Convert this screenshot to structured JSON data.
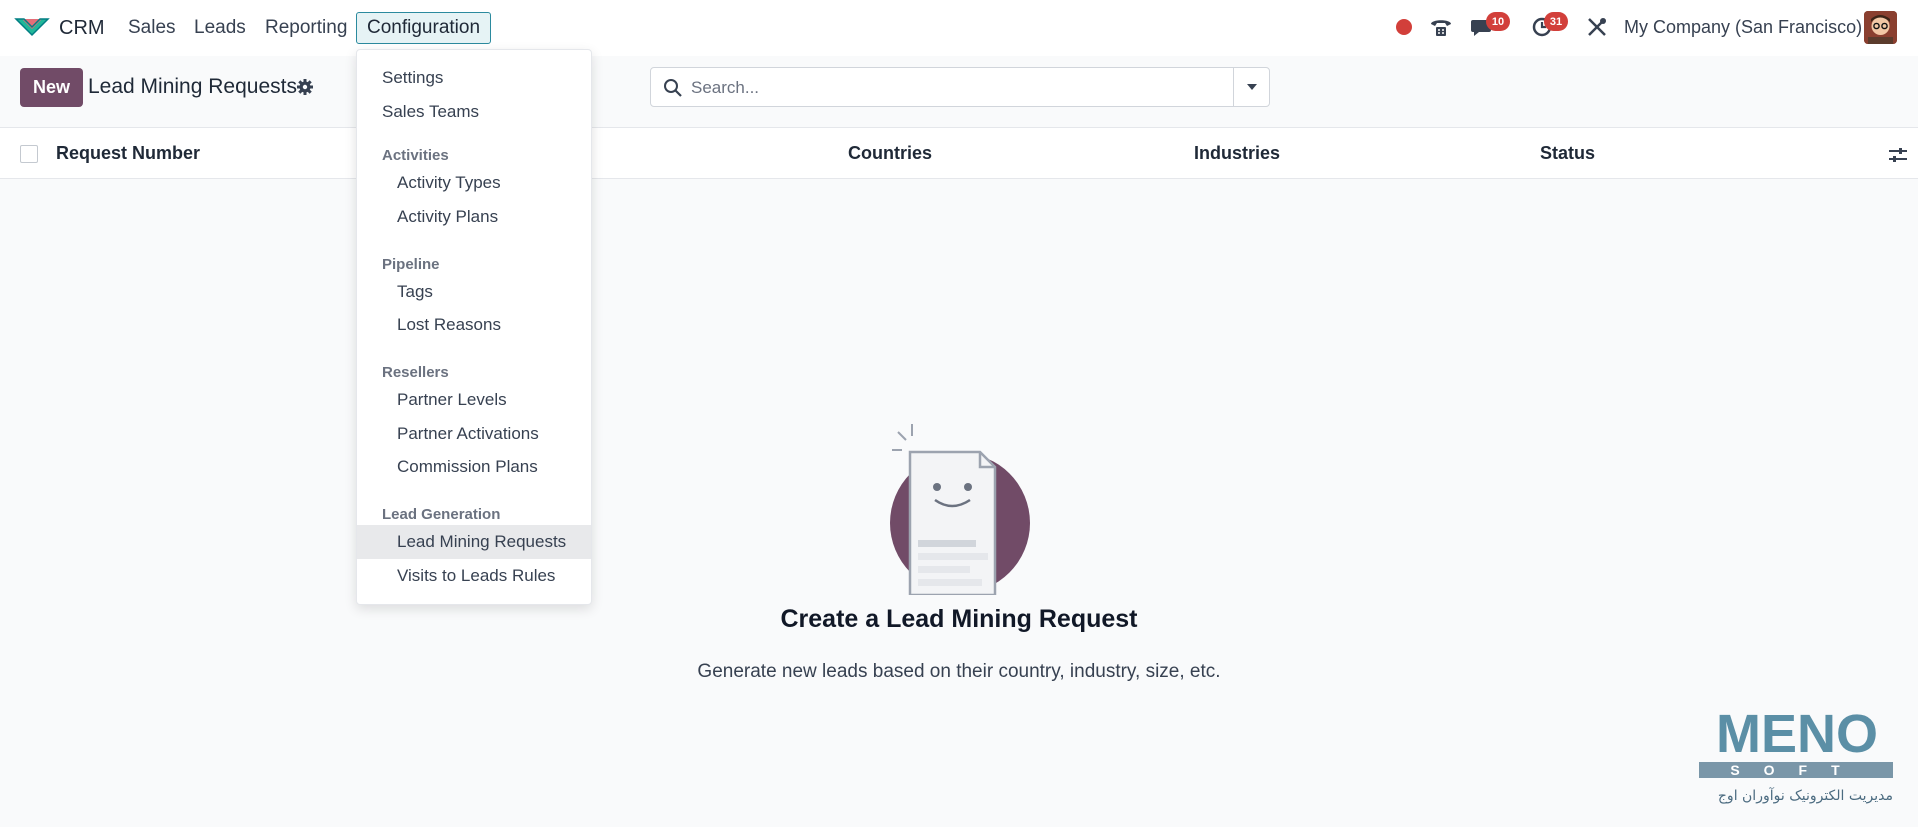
{
  "navbar": {
    "app_name": "CRM",
    "menu": [
      "Sales",
      "Leads",
      "Reporting",
      "Configuration"
    ],
    "company": "My Company (San Francisco)",
    "messages_badge": "10",
    "activities_badge": "31",
    "icons": [
      "crm-logo-icon",
      "recording-dot-icon",
      "phone-icon",
      "chat-icon",
      "clock-icon",
      "tools-icon",
      "avatar"
    ]
  },
  "control_panel": {
    "new_label": "New",
    "title": "Lead Mining Requests",
    "search_placeholder": "Search..."
  },
  "list": {
    "columns": [
      "Request Number",
      "Countries",
      "Industries",
      "Status"
    ]
  },
  "empty_state": {
    "title": "Create a Lead Mining Request",
    "subtitle": "Generate new leads based on their country, industry, size, etc."
  },
  "config_menu": {
    "settings": "Settings",
    "sales_teams": "Sales Teams",
    "activities_header": "Activities",
    "activity_types": "Activity Types",
    "activity_plans": "Activity Plans",
    "pipeline_header": "Pipeline",
    "tags": "Tags",
    "lost_reasons": "Lost Reasons",
    "resellers_header": "Resellers",
    "partner_levels": "Partner Levels",
    "partner_activations": "Partner Activations",
    "commission_plans": "Commission Plans",
    "lead_generation_header": "Lead Generation",
    "lead_mining_requests": "Lead Mining Requests",
    "visits_to_leads_rules": "Visits to Leads Rules"
  },
  "watermark": {
    "brand": "MENO",
    "sub": "SOFT",
    "tagline": "مدیریت الکترونیک نوآوران اوج"
  },
  "colors": {
    "primary": "#714b67",
    "accent": "#2b8a9e",
    "badge": "#d23f3a"
  }
}
